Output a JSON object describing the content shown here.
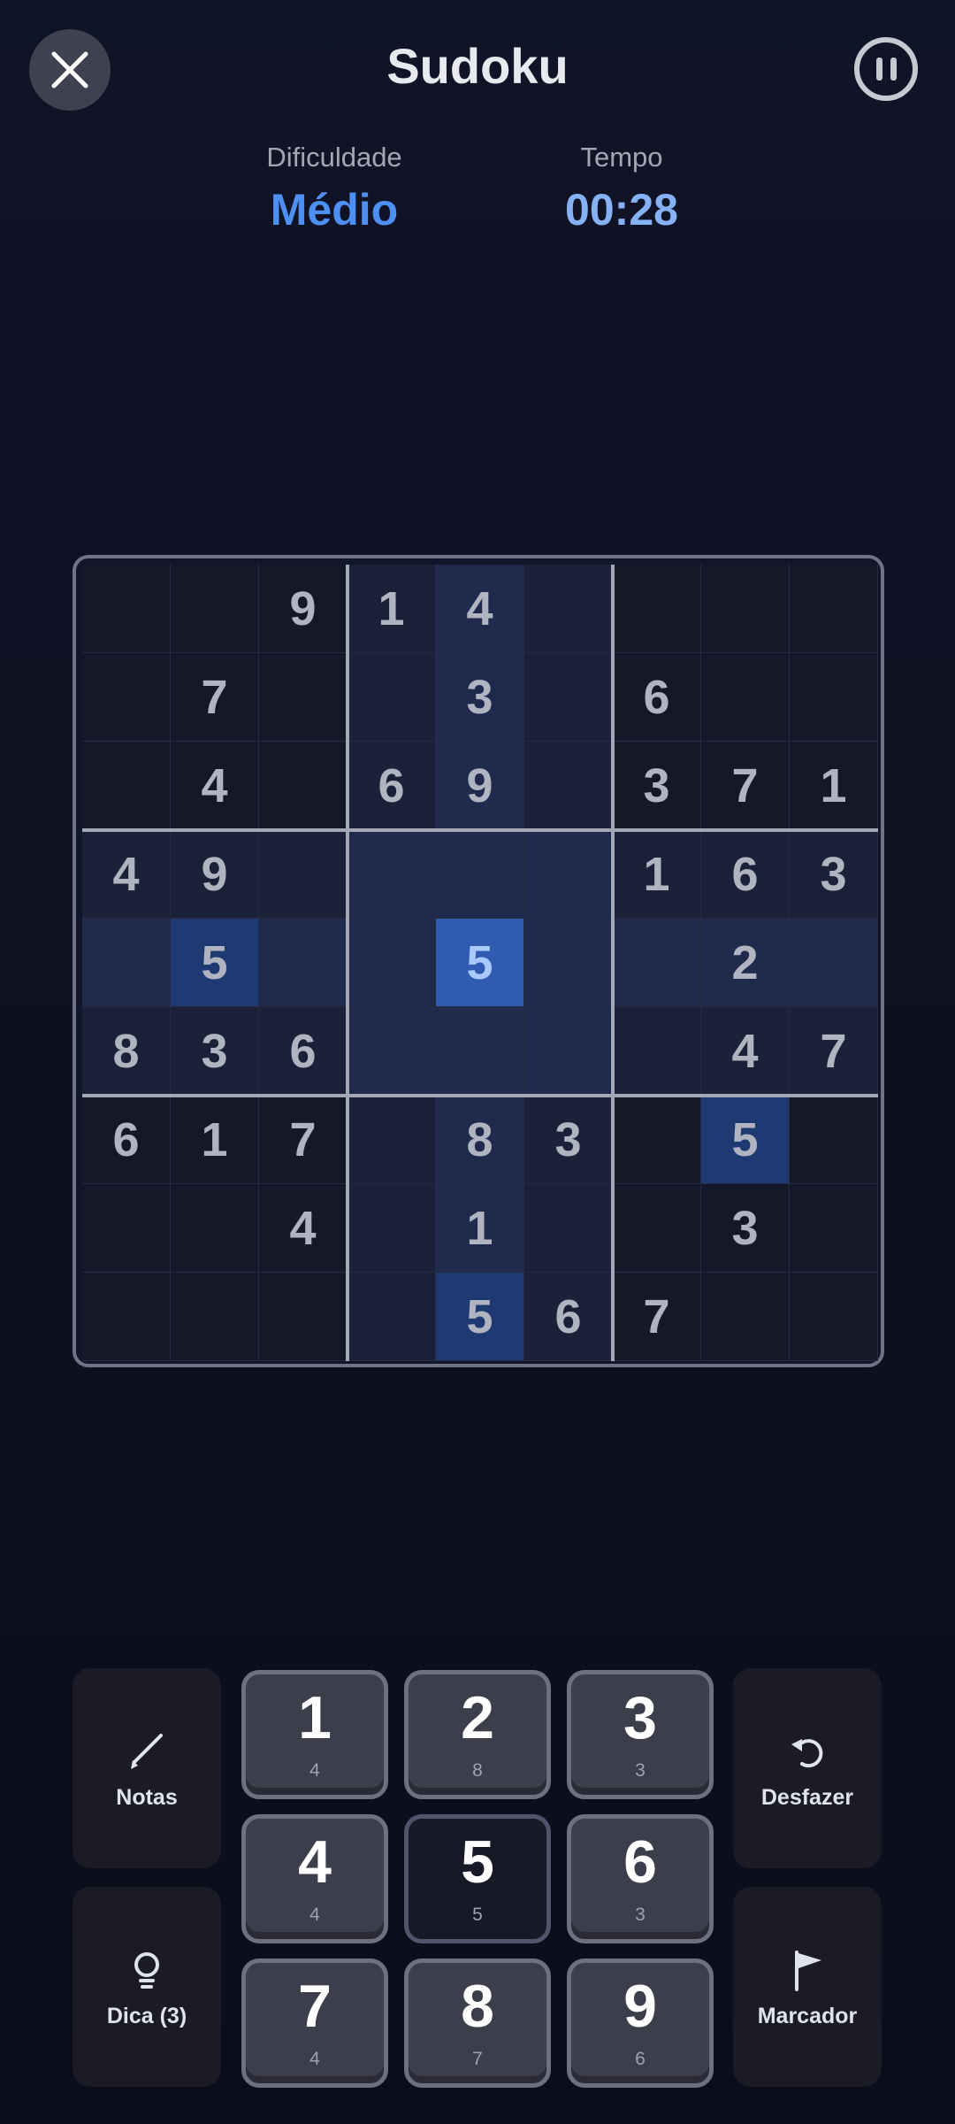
{
  "header": {
    "title": "Sudoku",
    "difficulty_label": "Dificuldade",
    "difficulty_value": "Médio",
    "time_label": "Tempo",
    "time_value": "00:28"
  },
  "board": {
    "rows": [
      [
        "",
        "",
        "9",
        "1",
        "4",
        "",
        "",
        "",
        ""
      ],
      [
        "",
        "7",
        "",
        "",
        "3",
        "",
        "6",
        "",
        ""
      ],
      [
        "",
        "4",
        "",
        "6",
        "9",
        "",
        "3",
        "7",
        "1"
      ],
      [
        "4",
        "9",
        "",
        "",
        "",
        "",
        "1",
        "6",
        "3"
      ],
      [
        "",
        "5",
        "",
        "",
        "5",
        "",
        "",
        "2",
        ""
      ],
      [
        "8",
        "3",
        "6",
        "",
        "",
        "",
        "",
        "4",
        "7"
      ],
      [
        "6",
        "1",
        "7",
        "",
        "8",
        "3",
        "",
        "5",
        ""
      ],
      [
        "",
        "",
        "4",
        "",
        "1",
        "",
        "",
        "3",
        ""
      ],
      [
        "",
        "",
        "",
        "",
        "5",
        "6",
        "7",
        "",
        ""
      ]
    ],
    "selected": [
      4,
      4
    ],
    "colors": {
      "cell": "#141828",
      "cell_alt": "#1b2138",
      "highlight": "#1f2a4d",
      "same_number": "#1f3a72",
      "selected": "#2f5bb0"
    }
  },
  "controls": {
    "notes_label": "Notas",
    "hint_label": "Dica (3)",
    "undo_label": "Desfazer",
    "flag_label": "Marcador",
    "numbers": [
      {
        "digit": "1",
        "remaining": "4"
      },
      {
        "digit": "2",
        "remaining": "8"
      },
      {
        "digit": "3",
        "remaining": "3"
      },
      {
        "digit": "4",
        "remaining": "4"
      },
      {
        "digit": "5",
        "remaining": "5"
      },
      {
        "digit": "6",
        "remaining": "3"
      },
      {
        "digit": "7",
        "remaining": "4"
      },
      {
        "digit": "8",
        "remaining": "7"
      },
      {
        "digit": "9",
        "remaining": "6"
      }
    ],
    "active_digit": "5"
  },
  "icons": {
    "close": "close-icon",
    "pause": "pause-icon",
    "notes": "pencil-icon",
    "hint": "lightbulb-icon",
    "undo": "undo-icon",
    "flag": "flag-icon"
  },
  "accent": "#4d8ff2"
}
